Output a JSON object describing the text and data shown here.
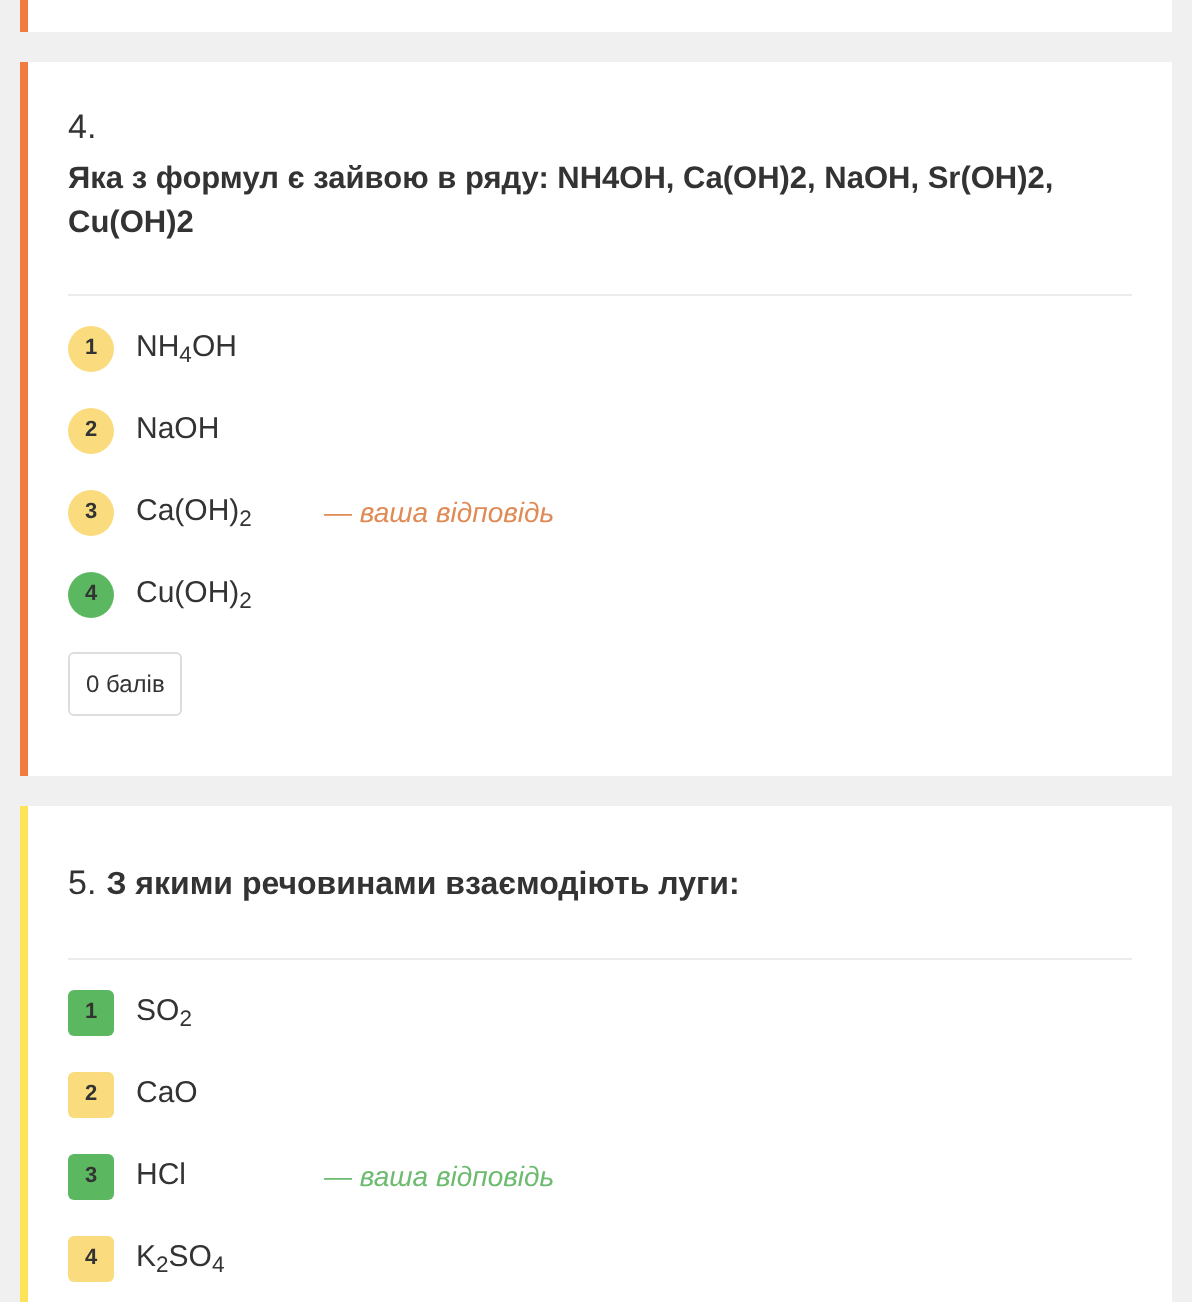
{
  "questions": [
    {
      "number": "4.",
      "title": "Яка з формул є зайвою в ряду: NH4OH, Ca(OH)2, NaOH, Sr(OH)2, Cu(OH)2",
      "number_own_line": true,
      "kind": "single",
      "color": "#f07d3f",
      "score": "0 балів",
      "options": [
        {
          "index": "1",
          "text": "NH$_{4}$OH",
          "correct": false
        },
        {
          "index": "2",
          "text": "NaOH",
          "correct": false
        },
        {
          "index": "3",
          "text": "Ca(OH)$_{2}$",
          "correct": false,
          "note": "— ваша відповідь"
        },
        {
          "index": "4",
          "text": "Cu(OH)$_{2}$",
          "correct": true
        }
      ]
    },
    {
      "number": "5.",
      "title": "З якими речовинами взаємодіють луги:",
      "number_own_line": false,
      "kind": "multi",
      "color": "#fce35a",
      "options": [
        {
          "index": "1",
          "text": "SO$_{2}$",
          "correct": true
        },
        {
          "index": "2",
          "text": "CaO",
          "correct": false
        },
        {
          "index": "3",
          "text": "HCl",
          "correct": true,
          "note": "— ваша відповідь"
        },
        {
          "index": "4",
          "text": "K$_{2}$SO$_{4}$",
          "correct": false
        }
      ]
    }
  ]
}
